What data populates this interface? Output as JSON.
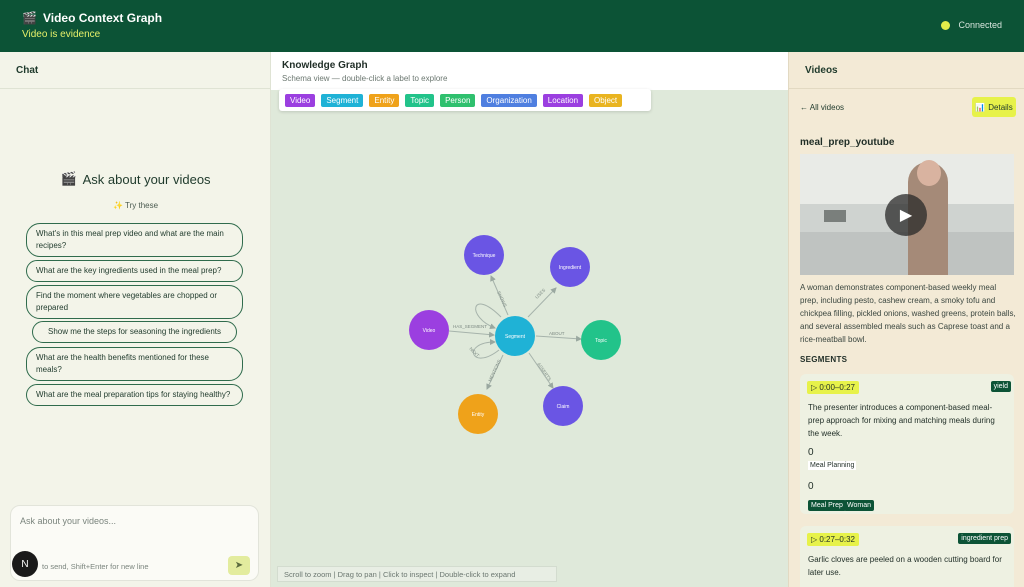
{
  "header": {
    "icon": "clapperboard-icon",
    "title": "Video Context Graph",
    "subtitle": "Video is evidence",
    "status": "Connected",
    "status_color": "#e2ec4a"
  },
  "chat": {
    "title": "Chat",
    "ask_title": "Ask about your videos",
    "try_label": "Try these",
    "suggestions": [
      "What's in this meal prep video and what are the main recipes?",
      "What are the key ingredients used in the meal prep?",
      "Find the moment where vegetables are chopped or prepared",
      "Show me the steps for seasoning the ingredients",
      "What are the health benefits mentioned for these meals?",
      "What are the meal preparation tips for staying healthy?"
    ],
    "input_placeholder": "Ask about your videos...",
    "input_hint": "to send, Shift+Enter for new line",
    "avatar": "N"
  },
  "graph": {
    "title": "Knowledge Graph",
    "subtitle": "Schema view — double-click a label to explore",
    "legend": [
      {
        "label": "Video",
        "color": "#9b3fe0"
      },
      {
        "label": "Segment",
        "color": "#1fb2d6"
      },
      {
        "label": "Entity",
        "color": "#efa21a"
      },
      {
        "label": "Topic",
        "color": "#22c38a"
      },
      {
        "label": "Person",
        "color": "#2fc06e"
      },
      {
        "label": "Organization",
        "color": "#4f7fe0"
      },
      {
        "label": "Location",
        "color": "#9b3fe0"
      },
      {
        "label": "Object",
        "color": "#e9b420"
      }
    ],
    "nodes": {
      "video": "Video",
      "segment": "Segment",
      "technique": "Technique",
      "ingredient": "Ingredient",
      "topic": "Topic",
      "claim": "Claim",
      "entity": "Entity"
    },
    "edges": {
      "has_segment": "HAS_SEGMENT",
      "about": "ABOUT",
      "uses": "USES",
      "mentions": "MENTIONS",
      "asserts": "ASSERTS",
      "shows": "SHOWS",
      "next": "NEXT"
    },
    "footer": "Scroll to zoom | Drag to pan | Click to inspect | Double-click to expand"
  },
  "videos": {
    "title": "Videos",
    "back": "← All videos",
    "details": "Details",
    "video_name": "meal_prep_youtube",
    "description": "A woman demonstrates component-based weekly meal prep, including pesto, cashew cream, a smoky tofu and chickpea filling, pickled onions, washed greens, protein balls, and several assembled meals such as Caprese toast and a rice-meatball bowl.",
    "segments_label": "SEGMENTS",
    "segments": [
      {
        "time": "▷ 0:00–0:27",
        "tag": "yield",
        "text": "The presenter introduces a component-based meal-prep approach for mixing and matching meals during the week.",
        "count1": "0",
        "topic": "Meal Planning",
        "count2": "0",
        "tags": [
          "Meal Prep",
          "Woman"
        ]
      },
      {
        "time": "▷ 0:27–0:32",
        "tag": "ingredient prep",
        "text": "Garlic cloves are peeled on a wooden cutting board for later use."
      }
    ]
  }
}
